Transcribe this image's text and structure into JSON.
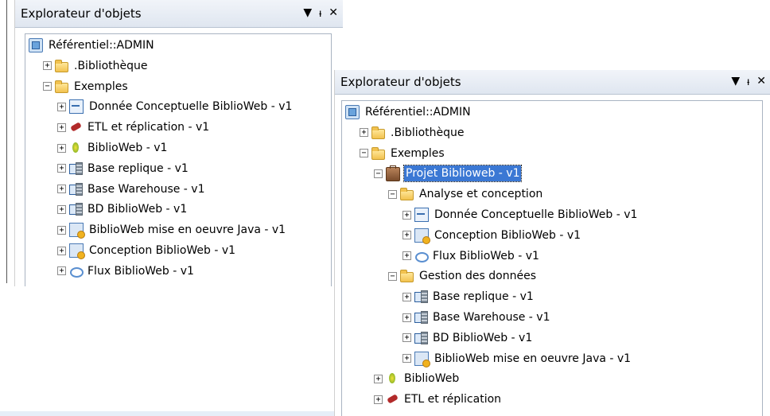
{
  "panel_a": {
    "title": "Explorateur d'objets",
    "controls": {
      "dropdown": "▼",
      "pin": "ᵼ",
      "close": "✕"
    },
    "tree": [
      {
        "label": "Référentiel::ADMIN",
        "icon": "repository-icon",
        "expander": ""
      },
      {
        "label": ".Bibliothèque",
        "icon": "folder-icon",
        "expander": "+"
      },
      {
        "label": "Exemples",
        "icon": "folder-icon",
        "expander": "−"
      },
      {
        "label": "Donnée Conceptuelle BiblioWeb - v1",
        "icon": "data-model-icon",
        "expander": "+"
      },
      {
        "label": "ETL et réplication - v1",
        "icon": "etl-icon",
        "expander": "+"
      },
      {
        "label": "BiblioWeb - v1",
        "icon": "web-app-icon",
        "expander": "+"
      },
      {
        "label": "Base replique - v1",
        "icon": "database-icon",
        "expander": "+"
      },
      {
        "label": "Base Warehouse - v1",
        "icon": "database-icon",
        "expander": "+"
      },
      {
        "label": "BD BiblioWeb - v1",
        "icon": "database-icon",
        "expander": "+"
      },
      {
        "label": "BiblioWeb mise en oeuvre Java - v1",
        "icon": "implementation-icon",
        "expander": "+"
      },
      {
        "label": "Conception BiblioWeb - v1",
        "icon": "implementation-icon",
        "expander": "+"
      },
      {
        "label": "Flux BiblioWeb - v1",
        "icon": "flow-icon",
        "expander": "+"
      }
    ]
  },
  "panel_b": {
    "title": "Explorateur d'objets",
    "controls": {
      "dropdown": "▼",
      "pin": "ᵼ",
      "close": "✕"
    },
    "tree": [
      {
        "label": "Référentiel::ADMIN",
        "icon": "repository-icon",
        "expander": ""
      },
      {
        "label": ".Bibliothèque",
        "icon": "folder-icon",
        "expander": "+"
      },
      {
        "label": "Exemples",
        "icon": "folder-icon",
        "expander": "−"
      },
      {
        "label": "Projet Biblioweb - v1",
        "icon": "project-icon",
        "expander": "−",
        "selected": true
      },
      {
        "label": "Analyse et conception",
        "icon": "folder-icon",
        "expander": "−"
      },
      {
        "label": "Donnée Conceptuelle BiblioWeb - v1",
        "icon": "data-model-icon",
        "expander": "+"
      },
      {
        "label": "Conception BiblioWeb - v1",
        "icon": "implementation-icon",
        "expander": "+"
      },
      {
        "label": "Flux BiblioWeb - v1",
        "icon": "flow-icon",
        "expander": "+"
      },
      {
        "label": "Gestion des données",
        "icon": "folder-icon",
        "expander": "−"
      },
      {
        "label": "Base replique - v1",
        "icon": "database-icon",
        "expander": "+"
      },
      {
        "label": "Base Warehouse - v1",
        "icon": "database-icon",
        "expander": "+"
      },
      {
        "label": "BD BiblioWeb - v1",
        "icon": "database-icon",
        "expander": "+"
      },
      {
        "label": "BiblioWeb mise en oeuvre Java - v1",
        "icon": "implementation-icon",
        "expander": "+"
      },
      {
        "label": "BiblioWeb",
        "icon": "web-app-icon",
        "expander": "+"
      },
      {
        "label": "ETL et réplication",
        "icon": "etl-icon",
        "expander": "+"
      }
    ]
  }
}
